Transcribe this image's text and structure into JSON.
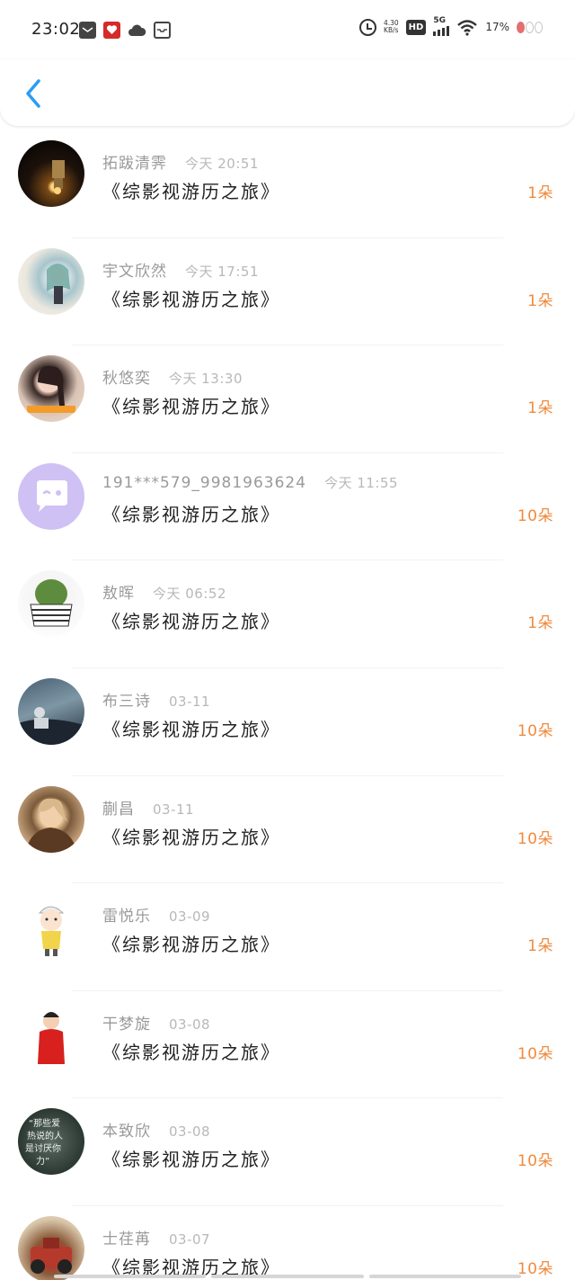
{
  "status_bar": {
    "time": "23:02",
    "net_speed_value": "4.30",
    "net_speed_unit": "KB/s",
    "hd_label": "HD",
    "network_label": "5G",
    "battery": "17%",
    "icons": [
      "message-icon",
      "red-app-icon",
      "cloud-icon",
      "inbox-icon",
      "alarm-icon",
      "hd-icon",
      "signal-icon",
      "wifi-icon",
      "battery-icon"
    ]
  },
  "header": {
    "back_icon": "chevron-left-icon",
    "accent_color": "#2a9df4"
  },
  "gifts": [
    {
      "name": "拓跋清霁",
      "time": "今天 20:51",
      "book": "《综影视游历之旅》",
      "count": "1朵"
    },
    {
      "name": "宇文欣然",
      "time": "今天 17:51",
      "book": "《综影视游历之旅》",
      "count": "1朵"
    },
    {
      "name": "秋悠奕",
      "time": "今天 13:30",
      "book": "《综影视游历之旅》",
      "count": "1朵"
    },
    {
      "name": "191***579_9981963624",
      "time": "今天 11:55",
      "book": "《综影视游历之旅》",
      "count": "10朵"
    },
    {
      "name": "敖晖",
      "time": "今天 06:52",
      "book": "《综影视游历之旅》",
      "count": "1朵"
    },
    {
      "name": "布三诗",
      "time": "03-11",
      "book": "《综影视游历之旅》",
      "count": "10朵"
    },
    {
      "name": "蒯昌",
      "time": "03-11",
      "book": "《综影视游历之旅》",
      "count": "10朵"
    },
    {
      "name": "雷悦乐",
      "time": "03-09",
      "book": "《综影视游历之旅》",
      "count": "1朵"
    },
    {
      "name": "干梦旋",
      "time": "03-08",
      "book": "《综影视游历之旅》",
      "count": "10朵"
    },
    {
      "name": "本致欣",
      "time": "03-08",
      "book": "《综影视游历之旅》",
      "count": "10朵"
    },
    {
      "name": "士荏苒",
      "time": "03-07",
      "book": "《综影视游历之旅》",
      "count": "10朵"
    }
  ],
  "avatar_text": {
    "av10_line1": "“那些爱",
    "av10_line2": "热说的人",
    "av10_line3": "是讨厌你",
    "av10_line4": "力”"
  },
  "colors": {
    "count": "#f08a3c",
    "name": "#9a9a9a",
    "time": "#b8b8b8",
    "title": "#222222",
    "back": "#2a9df4"
  }
}
